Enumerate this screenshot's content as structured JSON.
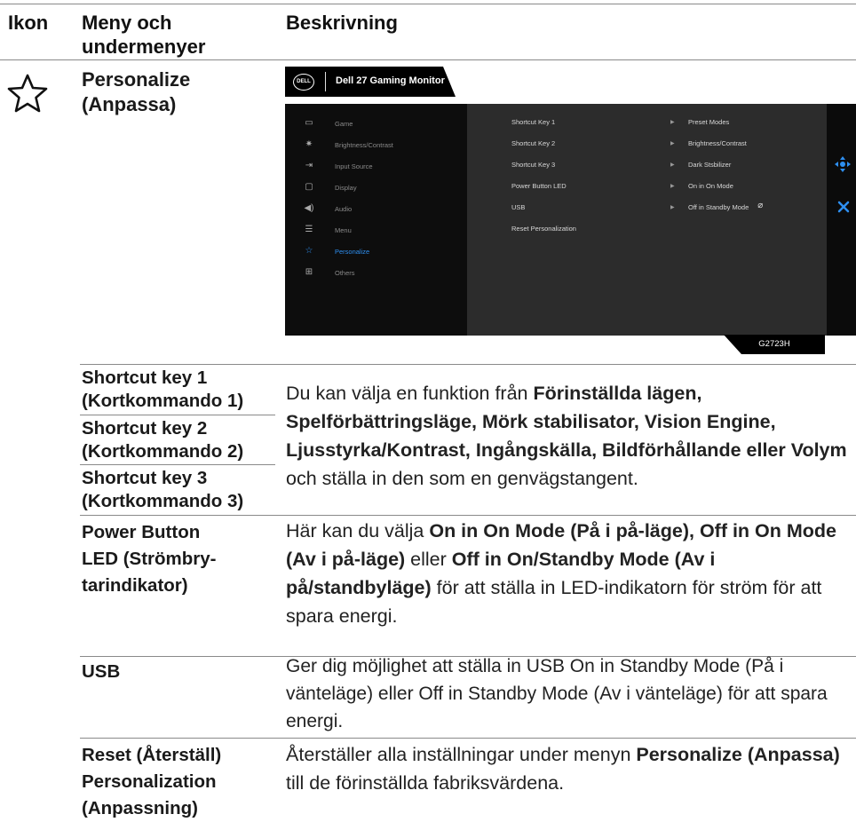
{
  "headers": {
    "icon": "Ikon",
    "menu": "Meny och\nundermenyer",
    "description": "Beskrivning"
  },
  "personalize_row": {
    "icon": "star-outline-icon",
    "title": "Personalize\n(Anpassa)"
  },
  "osd": {
    "title": "Dell 27 Gaming Monitor",
    "logo": "DELL",
    "menu_items": [
      {
        "icon": "game-icon",
        "label": "Game"
      },
      {
        "icon": "brightness-icon",
        "label": "Brightness/Contrast"
      },
      {
        "icon": "input-source-icon",
        "label": "Input Source"
      },
      {
        "icon": "display-icon",
        "label": "Display"
      },
      {
        "icon": "audio-icon",
        "label": "Audio"
      },
      {
        "icon": "menu-icon",
        "label": "Menu"
      },
      {
        "icon": "star-icon",
        "label": "Personalize"
      },
      {
        "icon": "others-icon",
        "label": "Others"
      }
    ],
    "active_item": "Personalize",
    "submenu": [
      {
        "label": "Shortcut Key 1",
        "value": "Preset Modes"
      },
      {
        "label": "Shortcut Key 2",
        "value": "Brightness/Contrast"
      },
      {
        "label": "Shortcut Key 3",
        "value": "Dark Stsbilizer"
      },
      {
        "label": "Power Button LED",
        "value": "On in On Mode"
      },
      {
        "label": "USB",
        "value": "Off in Standby Mode"
      },
      {
        "label": "Reset Personalization",
        "value": ""
      }
    ],
    "model": "G2723H",
    "accent_color": "#2e8ff0"
  },
  "rows": {
    "shortcut1": "Shortcut key 1\n(Kortkommando 1)",
    "shortcut2": "Shortcut key 2\n(Kortkommando 2)",
    "shortcut3": "Shortcut key 3\n(Kortkommando 3)",
    "shortcut_desc": {
      "t1": "Du kan välja en funktion från ",
      "b1": "Förinställda lägen, Spelförbättringsläge, Mörk stabilisator, Vision Engine, Ljusstyrka/Kontrast, Ingångskälla, Bildförhållande eller Volym",
      "t2": " och ställa in den som en genvägstangent."
    },
    "power_led": "Power Button\nLED (Strömbry-\ntarindikator)",
    "power_desc": {
      "t1": "Här kan du välja ",
      "b1": "On in On Mode (På i på-läge), Off in On Mode (Av i på-läge)",
      "t2": " eller ",
      "b2": "Off in On/Standby Mode (Av i på/standbyläge)",
      "t3": " för att ställa in LED-indikatorn för ström för att spara energi."
    },
    "usb": "USB",
    "usb_desc": "Ger dig möjlighet att ställa in USB On in Standby Mode (På i vänteläge) eller Off in Standby Mode (Av i vänteläge) för att spara energi.",
    "reset": "Reset (Återställ)\nPersonalization\n(Anpassning)",
    "reset_desc": {
      "t1": "Återställer alla inställningar under menyn ",
      "b1": "Personalize (Anpassa)",
      "t2": " till de förinställda fabriksvärdena."
    }
  }
}
